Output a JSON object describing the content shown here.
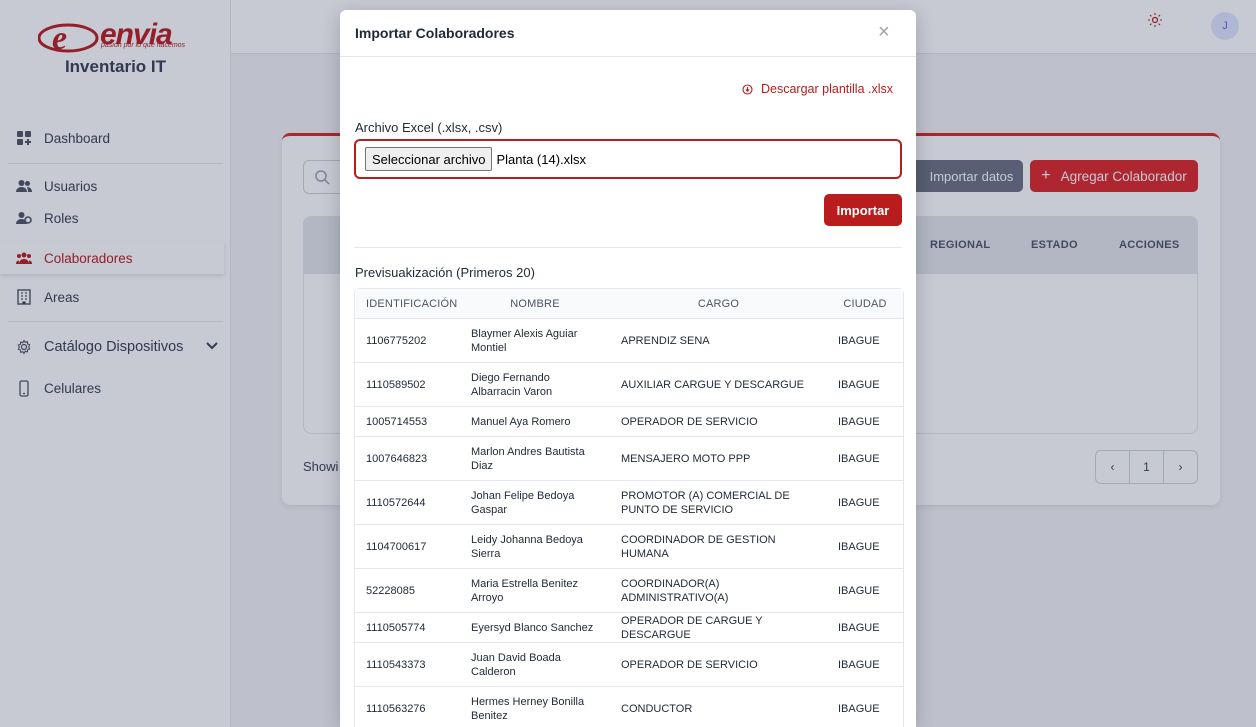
{
  "app": {
    "logo_text": "envia",
    "logo_tagline": "pasión por lo que hacemos",
    "name": "Inventario IT"
  },
  "colors": {
    "brand": "#b91c1c",
    "accent": "#dc2626"
  },
  "sidebar": {
    "items": [
      {
        "label": "Dashboard",
        "icon": "dashboard-icon"
      },
      {
        "label": "Usuarios",
        "icon": "users-icon"
      },
      {
        "label": "Roles",
        "icon": "roles-icon"
      },
      {
        "label": "Colaboradores",
        "icon": "collaborators-icon",
        "active": true
      },
      {
        "label": "Areas",
        "icon": "building-icon"
      },
      {
        "label": "Catálogo Dispositivos",
        "icon": "gear-icon"
      },
      {
        "label": "Celulares",
        "icon": "phone-icon"
      }
    ]
  },
  "topbar": {
    "avatar_initial": "J"
  },
  "background_page": {
    "import_button": "Importar datos",
    "add_button": "Agregar Colaborador",
    "columns": [
      "REGIONAL",
      "ESTADO",
      "ACCIONES"
    ],
    "showing_text": "Showi",
    "page_number": "1"
  },
  "modal": {
    "title": "Importar Colaboradores",
    "close": "×",
    "download_link": "Descargar plantilla .xlsx",
    "file_label": "Archivo Excel (.xlsx, .csv)",
    "file_button": "Seleccionar archivo",
    "file_name": "Planta (14).xlsx",
    "import_button": "Importar",
    "preview_title": "Previsuakización (Primeros 20)",
    "columns": [
      "IDENTIFICACIÓN",
      "NOMBRE",
      "CARGO",
      "CIUDAD"
    ],
    "rows": [
      {
        "id": "1106775202",
        "name": "Blaymer Alexis Aguiar Montiel",
        "cargo": "APRENDIZ SENA",
        "ciudad": "IBAGUE"
      },
      {
        "id": "1110589502",
        "name": "Diego Fernando Albarracin Varon",
        "cargo": "AUXILIAR CARGUE Y DESCARGUE",
        "ciudad": "IBAGUE"
      },
      {
        "id": "1005714553",
        "name": "Manuel Aya Romero",
        "cargo": "OPERADOR DE SERVICIO",
        "ciudad": "IBAGUE"
      },
      {
        "id": "1007646823",
        "name": "Marlon Andres Bautista Diaz",
        "cargo": "MENSAJERO MOTO PPP",
        "ciudad": "IBAGUE"
      },
      {
        "id": "1110572644",
        "name": "Johan Felipe Bedoya Gaspar",
        "cargo": "PROMOTOR (A) COMERCIAL DE PUNTO DE SERVICIO",
        "ciudad": "IBAGUE"
      },
      {
        "id": "1104700617",
        "name": "Leidy Johanna Bedoya Sierra",
        "cargo": "COORDINADOR DE GESTION HUMANA",
        "ciudad": "IBAGUE"
      },
      {
        "id": "52228085",
        "name": "Maria Estrella Benitez Arroyo",
        "cargo": "COORDINADOR(A) ADMINISTRATIVO(A)",
        "ciudad": "IBAGUE"
      },
      {
        "id": "1110505774",
        "name": "Eyersyd Blanco Sanchez",
        "cargo": "OPERADOR DE CARGUE Y DESCARGUE",
        "ciudad": "IBAGUE"
      },
      {
        "id": "1110543373",
        "name": "Juan David Boada Calderon",
        "cargo": "OPERADOR DE SERVICIO",
        "ciudad": "IBAGUE"
      },
      {
        "id": "1110563276",
        "name": "Hermes Herney Bonilla Benitez",
        "cargo": "CONDUCTOR",
        "ciudad": "IBAGUE"
      }
    ]
  }
}
